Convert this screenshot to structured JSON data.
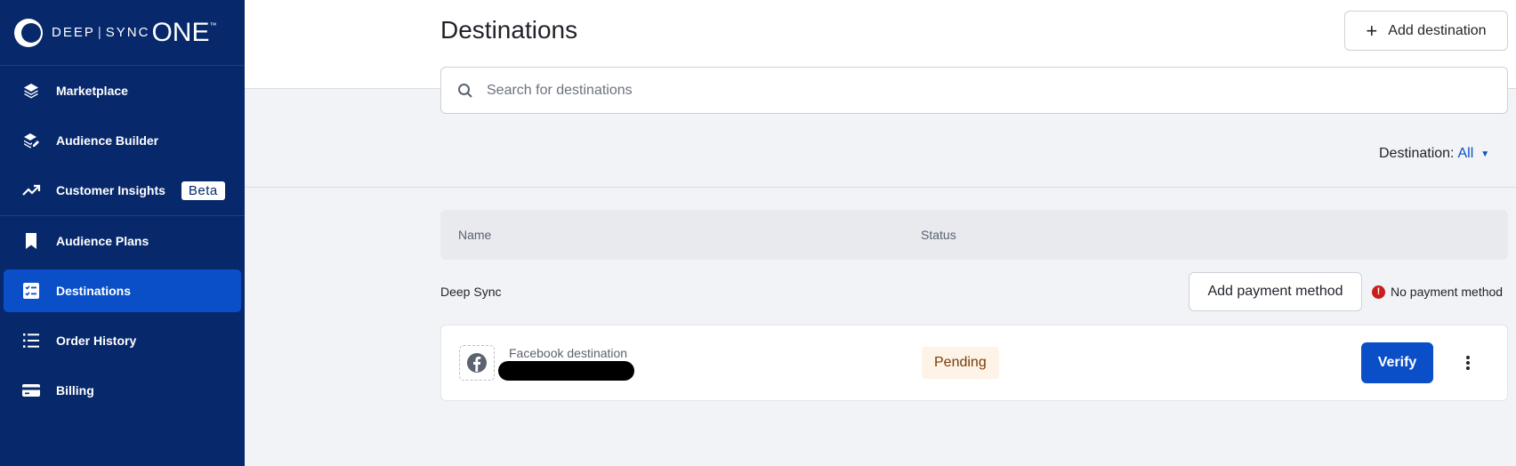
{
  "brand": {
    "part1": "DEEP",
    "separator": "|",
    "part2": "SYNC",
    "part3": "ONE",
    "trademark": "™"
  },
  "sidebar": {
    "items": [
      {
        "label": "Marketplace",
        "icon": "layers-icon"
      },
      {
        "label": "Audience Builder",
        "icon": "layers-edit-icon"
      },
      {
        "label": "Customer Insights",
        "icon": "trending-up-icon",
        "badge": "Beta"
      },
      {
        "label": "Audience Plans",
        "icon": "bookmark-icon"
      },
      {
        "label": "Destinations",
        "icon": "checklist-icon",
        "active": true
      },
      {
        "label": "Order History",
        "icon": "list-icon"
      },
      {
        "label": "Billing",
        "icon": "credit-card-icon"
      }
    ]
  },
  "header": {
    "title": "Destinations",
    "add_button": "Add destination"
  },
  "search": {
    "placeholder": "Search for destinations"
  },
  "filter": {
    "label": "Destination:",
    "value": "All"
  },
  "table": {
    "columns": [
      "Name",
      "Status"
    ],
    "group": {
      "name": "Deep Sync",
      "payment_button": "Add payment method",
      "payment_status": "No payment method"
    },
    "rows": [
      {
        "type": "Facebook destination",
        "icon": "facebook-icon",
        "status": "Pending",
        "action": "Verify"
      }
    ]
  },
  "colors": {
    "sidebar_bg": "#07296b",
    "accent": "#0a4fc7",
    "pending_bg": "#fdf3e6",
    "error": "#c81e1e"
  }
}
